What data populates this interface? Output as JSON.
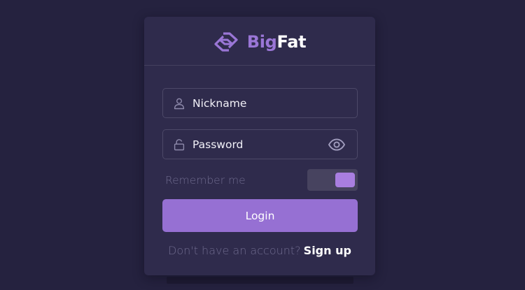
{
  "brand": {
    "name_part1": "Big",
    "name_part2": "Fat",
    "logo_icon": "layered-diamond-logo-icon"
  },
  "form": {
    "nickname": {
      "placeholder": "Nickname",
      "value": "",
      "icon": "user-icon"
    },
    "password": {
      "placeholder": "Password",
      "value": "",
      "icon": "lock-icon",
      "toggle_icon": "eye-icon"
    },
    "remember": {
      "label": "Remember me",
      "checked": true
    },
    "login_label": "Login",
    "signup_prompt": "Don't have an account?",
    "signup_link": "Sign up"
  },
  "colors": {
    "background": "#25223f",
    "card": "#2f2b4c",
    "accent": "#9670d3",
    "brand_accent": "#9a76d6",
    "muted_text": "#6e6a8d"
  }
}
